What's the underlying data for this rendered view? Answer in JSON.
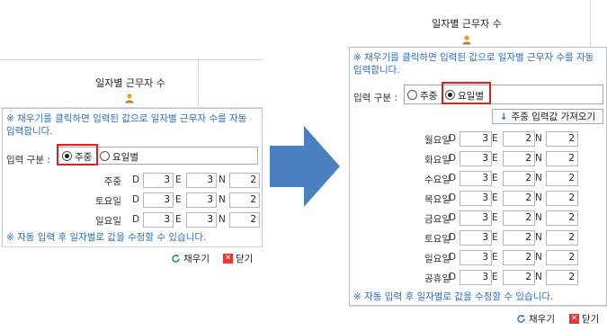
{
  "left": {
    "title": "일자별 근무자 수",
    "notice": "※ 채우기를 클릭하면 입력된 값으로 일자별 근무자 수를 자동 입력합니다.",
    "input_type_label": "입력 구분 :",
    "radio_weekday": "주중",
    "radio_daily": "요일별",
    "selected": "주중",
    "rows": [
      {
        "label": "주중",
        "D": "3",
        "E": "3",
        "N": "2"
      },
      {
        "label": "토요일",
        "D": "3",
        "E": "3",
        "N": "2"
      },
      {
        "label": "일요일",
        "D": "3",
        "E": "3",
        "N": "2"
      }
    ],
    "footer_note": "※ 자동 입력 후 일자별로 값을 수정할 수 있습니다.",
    "fill_button": "채우기",
    "close_button": "닫기"
  },
  "right": {
    "title": "일자별 근무자 수",
    "notice": "※ 채우기를 클릭하면 입력된 값으로 일자별 근무자 수를 자동 입력합니다.",
    "input_type_label": "입력 구분 :",
    "radio_weekday": "주중",
    "radio_daily": "요일별",
    "selected": "요일별",
    "fetch_button": "주중 입력값 가져오기",
    "rows": [
      {
        "label": "월요일",
        "D": "3",
        "E": "2",
        "N": "2"
      },
      {
        "label": "화요일",
        "D": "3",
        "E": "2",
        "N": "2"
      },
      {
        "label": "수요일",
        "D": "3",
        "E": "2",
        "N": "2"
      },
      {
        "label": "목요일",
        "D": "3",
        "E": "2",
        "N": "2"
      },
      {
        "label": "금요일",
        "D": "3",
        "E": "2",
        "N": "2"
      },
      {
        "label": "토요일",
        "D": "3",
        "E": "2",
        "N": "2"
      },
      {
        "label": "일요일",
        "D": "3",
        "E": "2",
        "N": "2"
      },
      {
        "label": "공휴일",
        "D": "3",
        "E": "2",
        "N": "2"
      }
    ],
    "footer_note": "※ 자동 입력 후 일자별로 값을 수정할 수 있습니다.",
    "fill_button": "채우기",
    "close_button": "닫기"
  },
  "shift_letters": [
    "D",
    "E",
    "N"
  ],
  "colors": {
    "accent_blue": "#2a6ec8",
    "highlight_red": "#e02020",
    "arrow_blue": "#4a7fc1"
  }
}
